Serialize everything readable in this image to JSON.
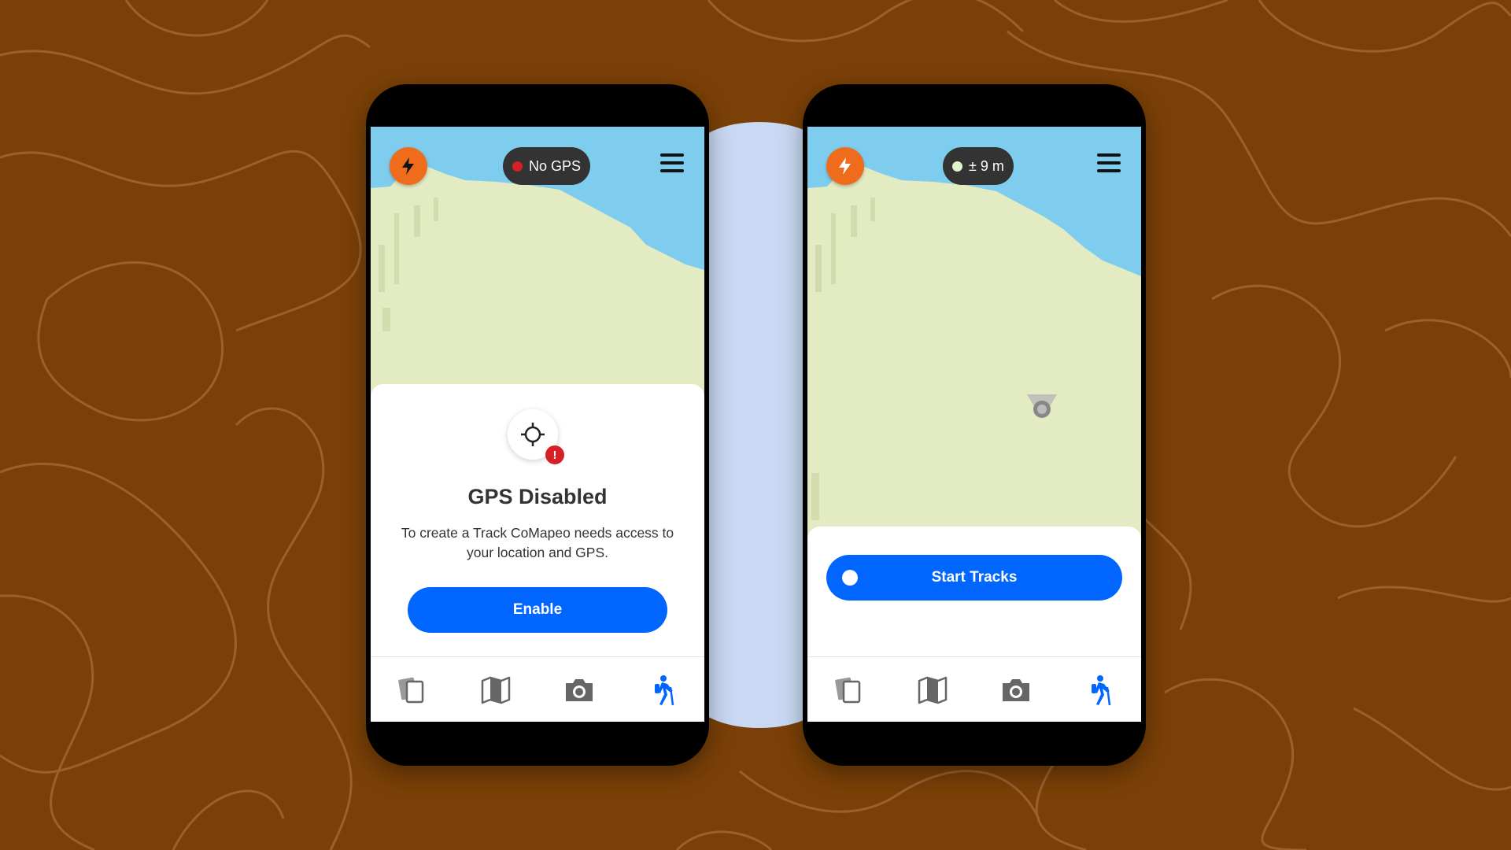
{
  "colors": {
    "background": "#7a4007",
    "accent_orange": "#ef6c1c",
    "primary_blue": "#0066ff",
    "error_red": "#d71f26",
    "gps_ok_green": "#dff4c9",
    "water": "#7ecdee",
    "land": "#e3ebc3"
  },
  "phone_left": {
    "gps_status": "No GPS",
    "sheet": {
      "title": "GPS Disabled",
      "body": "To create a Track CoMapeo needs access to your location and GPS.",
      "button_label": "Enable"
    },
    "nav": [
      {
        "icon": "observations-icon",
        "active": false
      },
      {
        "icon": "map-icon",
        "active": false
      },
      {
        "icon": "camera-icon",
        "active": false
      },
      {
        "icon": "hiker-icon",
        "active": true
      }
    ]
  },
  "phone_right": {
    "gps_status": "± 9 m",
    "sheet": {
      "button_label": "Start Tracks"
    },
    "nav": [
      {
        "icon": "observations-icon",
        "active": false
      },
      {
        "icon": "map-icon",
        "active": false
      },
      {
        "icon": "camera-icon",
        "active": false
      },
      {
        "icon": "hiker-icon",
        "active": true
      }
    ]
  }
}
